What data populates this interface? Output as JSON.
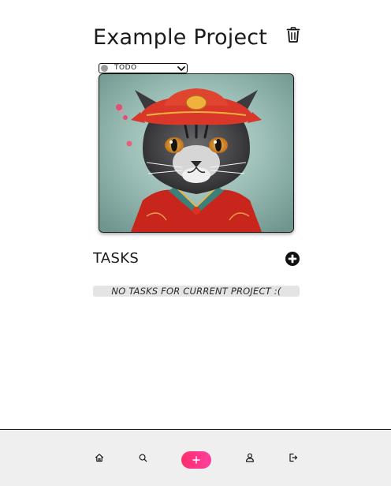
{
  "project": {
    "title": "Example Project",
    "status": {
      "selected": "TODO",
      "dot_color": "#9a9a9a"
    },
    "image_alt": "cat-portrait"
  },
  "tasks": {
    "heading": "TASKS",
    "empty_message": "NO TASKS FOR CURRENT PROJECT :("
  },
  "icons": {
    "delete": "trash-icon",
    "add_task": "plus-circle-icon",
    "status_chevron": "chevron-down-icon"
  },
  "bottom_nav": {
    "items": [
      {
        "name": "home",
        "icon": "home-icon"
      },
      {
        "name": "search",
        "icon": "search-icon"
      },
      {
        "name": "add",
        "icon": "plus-icon"
      },
      {
        "name": "profile",
        "icon": "user-icon"
      },
      {
        "name": "logout",
        "icon": "logout-icon"
      }
    ],
    "add_gradient": [
      "#ff2d6b",
      "#ff3fa0"
    ]
  }
}
